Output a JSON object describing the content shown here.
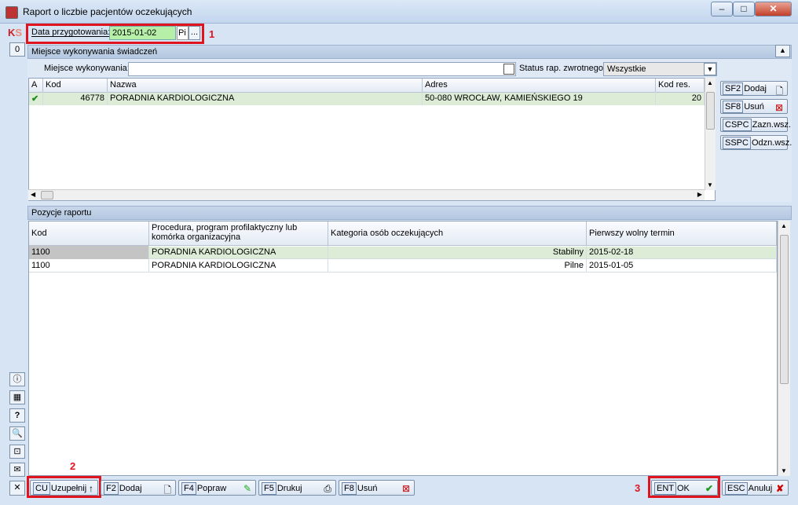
{
  "window": {
    "title": "Raport o liczbie pacjentów oczekujących"
  },
  "header": {
    "date_label": "Data przygotowania:",
    "date_value": "2015-01-02",
    "date_day": "Pi",
    "more_label": "...",
    "annotations": [
      "1",
      "2",
      "3"
    ]
  },
  "section1": {
    "title": "Miejsce wykonywania świadczeń",
    "place_label": "Miejsce wykonywania:",
    "place_value": "",
    "status_label": "Status rap. zwrotnego:",
    "status_value": "Wszystkie",
    "columns": [
      "A",
      "Kod",
      "Nazwa",
      "Adres",
      "Kod res."
    ],
    "rows": [
      {
        "a": "✔",
        "kod": "46778",
        "nazwa": "PORADNIA KARDIOLOGICZNA",
        "adres": "50-080 WROCŁAW, KAMIEŃSKIEGO 19",
        "kod_res": "20"
      }
    ],
    "buttons": [
      {
        "key": "SF2",
        "label": "Dodaj"
      },
      {
        "key": "SF8",
        "label": "Usuń"
      },
      {
        "key": "CSPC",
        "label": "Zazn.wsz."
      },
      {
        "key": "SSPC",
        "label": "Odzn.wsz."
      }
    ]
  },
  "section2": {
    "title": "Pozycje raportu",
    "columns": [
      "Kod",
      "Procedura, program profilaktyczny lub komórka organizacyjna",
      "Kategoria osób oczekujących",
      "Pierwszy wolny termin"
    ],
    "rows": [
      {
        "kod": "1100",
        "procedura": "PORADNIA KARDIOLOGICZNA",
        "kategoria": "Stabilny",
        "termin": "2015-02-18"
      },
      {
        "kod": "1100",
        "procedura": "PORADNIA KARDIOLOGICZNA",
        "kategoria": "Pilne",
        "termin": "2015-01-05"
      }
    ]
  },
  "left_strip": {
    "zero_label": "0",
    "question_label": "?"
  },
  "toolbar": {
    "close_label": "✕",
    "buttons": [
      {
        "key": "CU",
        "label": "Uzupełnij"
      },
      {
        "key": "F2",
        "label": "Dodaj"
      },
      {
        "key": "F4",
        "label": "Popraw"
      },
      {
        "key": "F5",
        "label": "Drukuj"
      },
      {
        "key": "F8",
        "label": "Usuń"
      }
    ],
    "ok": {
      "key": "ENT",
      "label": "OK"
    },
    "cancel": {
      "key": "ESC",
      "label": "Anuluj"
    }
  }
}
